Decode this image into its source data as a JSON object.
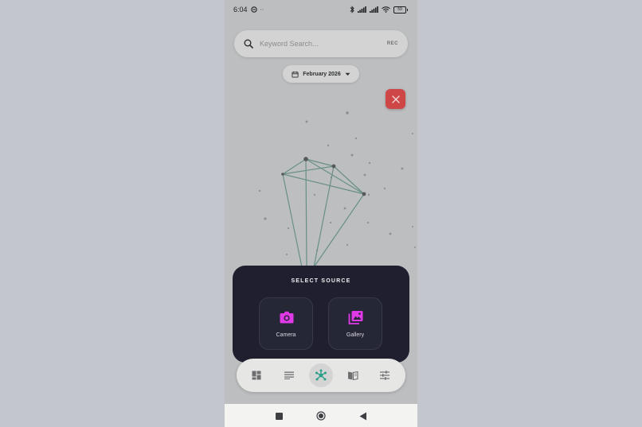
{
  "status_bar": {
    "time": "6:04",
    "extra_indicators": "··",
    "battery_level": "59",
    "icons": [
      "do-not-disturb-icon",
      "bluetooth-icon",
      "signal-icon",
      "signal-icon",
      "wifi-icon",
      "battery-icon"
    ]
  },
  "search": {
    "placeholder": "Keyword Search...",
    "value": "",
    "rec_label": "REC"
  },
  "month_picker": {
    "label": "February 2026",
    "icon": "calendar-icon"
  },
  "source_sheet": {
    "title": "SELECT SOURCE",
    "camera_label": "Camera",
    "gallery_label": "Gallery",
    "accent_color": "#e03ae6"
  },
  "bottom_nav": {
    "items": [
      "dashboard-icon",
      "list-icon",
      "graph-icon",
      "book-icon",
      "sliders-icon"
    ],
    "active_color": "#2a9f88"
  },
  "colors": {
    "close_button": "#cf4647",
    "graph_edges": "#3f8f77",
    "sheet_background": "#1f1f30"
  }
}
